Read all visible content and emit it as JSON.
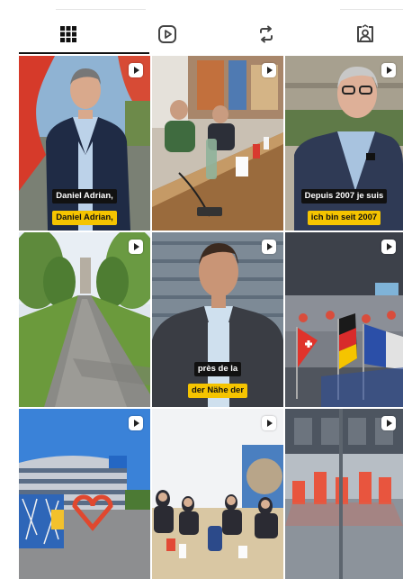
{
  "tabs": [
    {
      "name": "grid",
      "icon": "grid-icon",
      "active": true
    },
    {
      "name": "reels",
      "icon": "reels-play-icon",
      "active": false
    },
    {
      "name": "reposts",
      "icon": "repost-icon",
      "active": false
    },
    {
      "name": "tagged",
      "icon": "tagged-person-icon",
      "active": false
    }
  ],
  "posts": [
    {
      "type": "reel",
      "caption_top": "Daniel Adrian,",
      "caption_bottom": "Daniel Adrian,"
    },
    {
      "type": "reel"
    },
    {
      "type": "reel",
      "caption_top": "Depuis 2007 je suis",
      "caption_bottom": "ich bin seit 2007"
    },
    {
      "type": "reel"
    },
    {
      "type": "reel",
      "caption_top": "près de la",
      "caption_bottom": "der Nähe der"
    },
    {
      "type": "reel"
    },
    {
      "type": "reel"
    },
    {
      "type": "reel"
    },
    {
      "type": "reel"
    }
  ],
  "colors": {
    "indicator": "#111111",
    "caption_highlight": "#f5c400"
  }
}
